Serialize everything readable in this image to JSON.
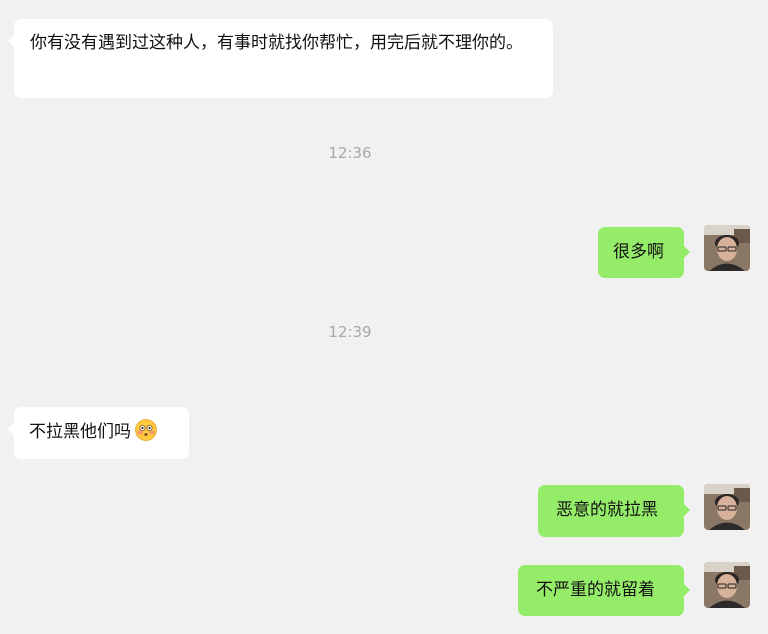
{
  "messages": [
    {
      "from": "other",
      "text": "你有没有遇到过这种人，有事时就找你帮忙，用完后就不理你的。"
    },
    {
      "type": "timestamp",
      "text": "12:36"
    },
    {
      "from": "me",
      "text": "很多啊"
    },
    {
      "type": "timestamp",
      "text": "12:39"
    },
    {
      "from": "other",
      "text": "不拉黑他们吗",
      "emoji": "flushed-face-icon"
    },
    {
      "from": "me",
      "text": "恶意的就拉黑"
    },
    {
      "from": "me",
      "text": "不严重的就留着"
    }
  ],
  "colors": {
    "background": "#f1f1f1",
    "incoming_bubble": "#ffffff",
    "outgoing_bubble": "#95ec69",
    "timestamp_text": "#a8a8a8"
  },
  "avatar": {
    "icon": "user-avatar-photo"
  }
}
